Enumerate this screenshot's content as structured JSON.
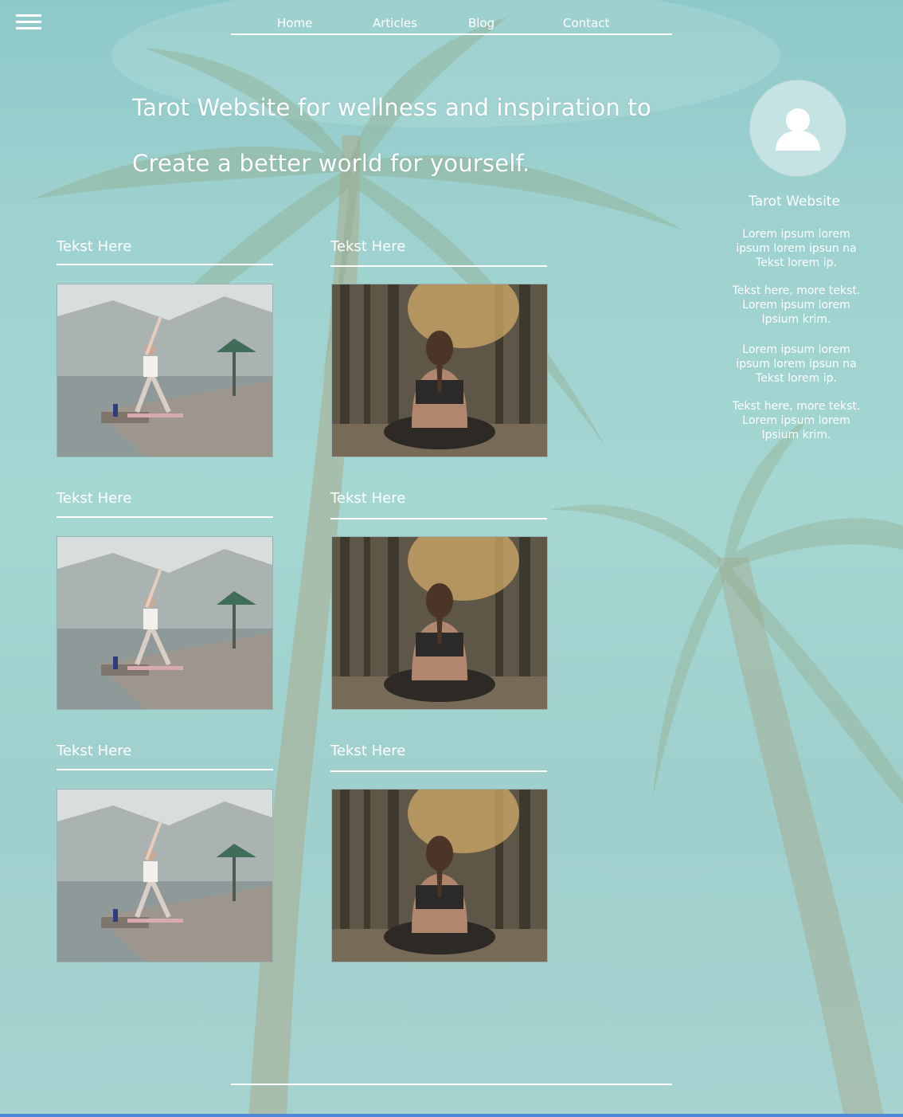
{
  "nav": {
    "menu_icon": "hamburger-icon",
    "links": [
      "Home",
      "Articles",
      "Blog",
      "Contact"
    ]
  },
  "hero": {
    "line1": "Tarot Website for wellness and inspiration to",
    "line2": "Create a better world for yourself."
  },
  "cards": [
    {
      "title": "Tekst Here",
      "image": "yoga-pose-on-lake-dock"
    },
    {
      "title": "Tekst Here",
      "image": "meditation-in-forest"
    },
    {
      "title": "Tekst Here",
      "image": "yoga-pose-on-lake-dock"
    },
    {
      "title": "Tekst Here",
      "image": "meditation-in-forest"
    },
    {
      "title": "Tekst Here",
      "image": "yoga-pose-on-lake-dock"
    },
    {
      "title": "Tekst Here",
      "image": "meditation-in-forest"
    }
  ],
  "profile": {
    "avatar_icon": "user-avatar-icon",
    "name": "Tarot Website",
    "paragraphs": [
      "Lorem ipsum lorem ipsum lorem ipsun na Tekst lorem ip.",
      "Tekst here, more tekst. Lorem ipsum lorem Ipsium krim.",
      "Lorem ipsum lorem ipsum lorem ipsun na Tekst lorem ip.",
      "Tekst here, more tekst. Lorem ipsum lorem Ipsium krim."
    ]
  },
  "colors": {
    "sky": "#9ed2d0",
    "text": "#ffffff",
    "accent_bottom": "#4f86d6"
  }
}
